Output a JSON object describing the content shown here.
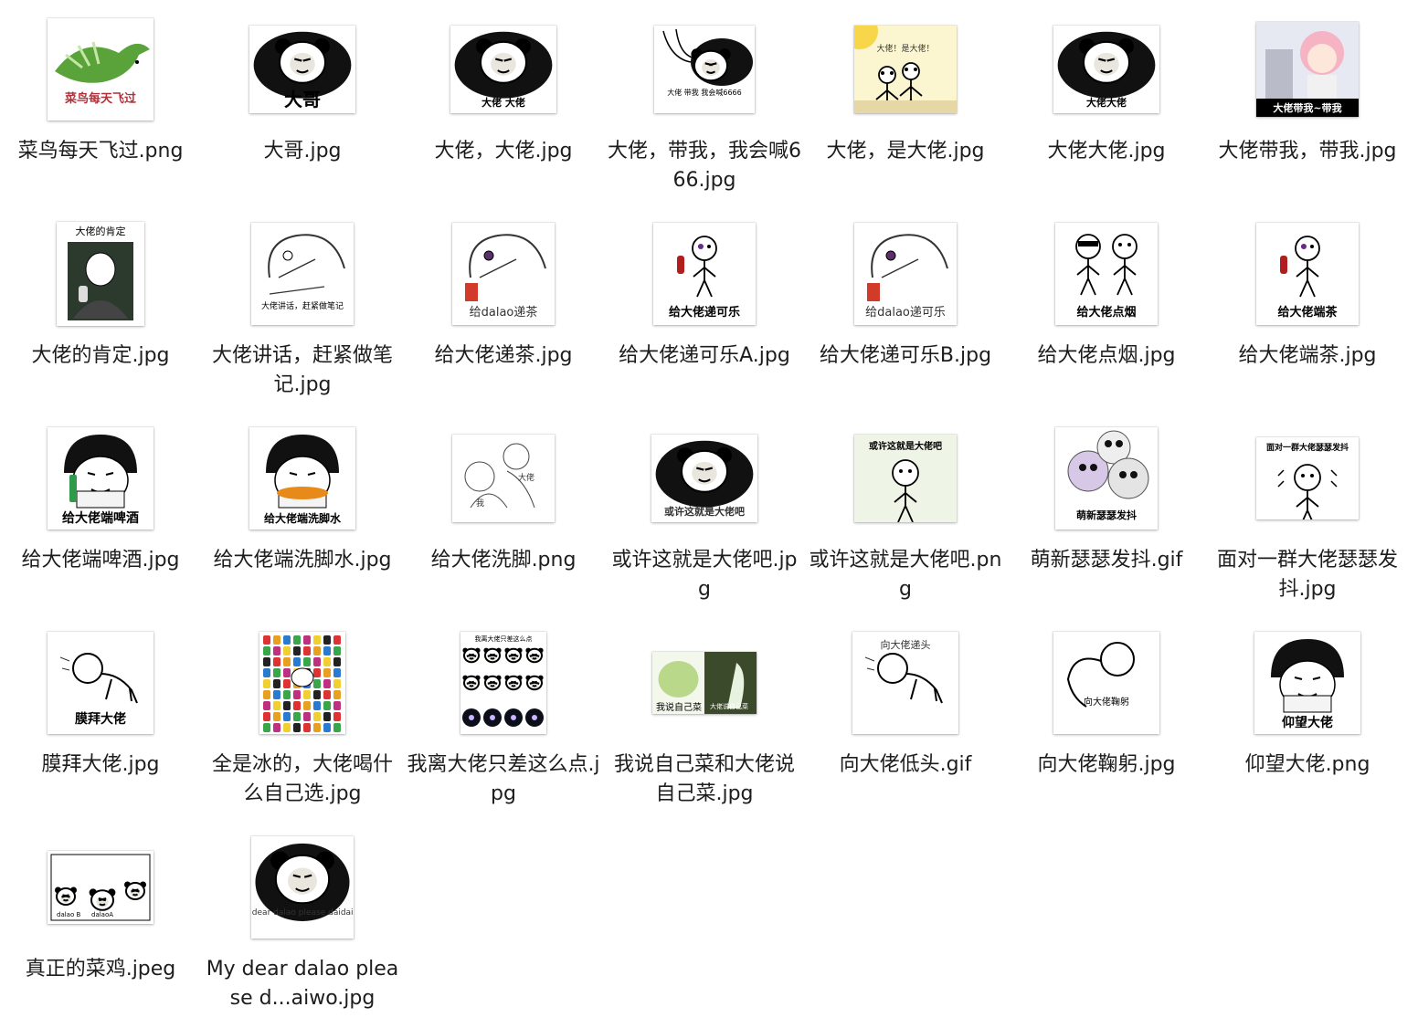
{
  "files": [
    {
      "name": "菜鸟每天飞过.png",
      "caption": "菜鸟每天飞过",
      "caption_color": "#b0303a",
      "kind": "bird"
    },
    {
      "name": "大哥.jpg",
      "caption": "大哥",
      "caption_color": "#000000",
      "kind": "panda"
    },
    {
      "name": "大佬，大佬.jpg",
      "caption": "大佬  大佬",
      "caption_color": "#000000",
      "kind": "panda"
    },
    {
      "name": "大佬，带我，我会喊666.jpg",
      "caption": "大佬 带我 我会喊6666",
      "caption_color": "#000000",
      "kind": "panda-lean"
    },
    {
      "name": "大佬，是大佬.jpg",
      "caption": "大佬！是大佬！",
      "caption_color": "#333333",
      "kind": "sun"
    },
    {
      "name": "大佬大佬.jpg",
      "caption": "大佬大佬",
      "caption_color": "#000000",
      "kind": "panda"
    },
    {
      "name": "大佬带我，带我.jpg",
      "caption": "大佬带我~带我",
      "caption_color": "#000000",
      "kind": "anime"
    },
    {
      "name": "大佬的肯定.jpg",
      "caption": "大佬的肯定",
      "caption_color": "#000000",
      "kind": "thumbsup"
    },
    {
      "name": "大佬讲话，赶紧做笔记.jpg",
      "caption": "大佬讲话，赶紧做笔记",
      "caption_color": "#000000",
      "kind": "sketch"
    },
    {
      "name": "给大佬递茶.jpg",
      "caption": "给dalao递茶",
      "caption_color": "#333333",
      "kind": "sketch-cup"
    },
    {
      "name": "给大佬递可乐A.jpg",
      "caption": "给大佬递可乐",
      "caption_color": "#000000",
      "kind": "stick-cola"
    },
    {
      "name": "给大佬递可乐B.jpg",
      "caption": "给dalao递可乐",
      "caption_color": "#333333",
      "kind": "sketch-cup"
    },
    {
      "name": "给大佬点烟.jpg",
      "caption": "给大佬点烟",
      "caption_color": "#000000",
      "kind": "stick-two"
    },
    {
      "name": "给大佬端茶.jpg",
      "caption": "给大佬端茶",
      "caption_color": "#000000",
      "kind": "stick-cola"
    },
    {
      "name": "给大佬端啤酒.jpg",
      "caption": "给大佬端啤酒",
      "caption_color": "#000000",
      "kind": "mushroom"
    },
    {
      "name": "给大佬端洗脚水.jpg",
      "caption": "给大佬端洗脚水",
      "caption_color": "#000000",
      "kind": "mushroom"
    },
    {
      "name": "给大佬洗脚.png",
      "caption": "大佬  我",
      "caption_color": "#333333",
      "kind": "sketch-two"
    },
    {
      "name": "或许这就是大佬吧.jpg",
      "caption": "或许这就是大佬吧",
      "caption_color": "#333333",
      "kind": "panda"
    },
    {
      "name": "或许这就是大佬吧.png",
      "caption": "或许这就是大佬吧",
      "caption_color": "#000000",
      "kind": "stick-green"
    },
    {
      "name": "萌新瑟瑟发抖.gif",
      "caption": "萌新瑟瑟发抖",
      "caption_color": "#000000",
      "kind": "skulls"
    },
    {
      "name": "面对一群大佬瑟瑟发抖.jpg",
      "caption": "面对一群大佬瑟瑟发抖",
      "caption_color": "#000000",
      "kind": "shiver"
    },
    {
      "name": "膜拜大佬.jpg",
      "caption": "膜拜大佬",
      "caption_color": "#000000",
      "kind": "kneel"
    },
    {
      "name": "全是冰的，大佬喝什么自己选.jpg",
      "caption": "",
      "caption_color": "#000000",
      "kind": "drinks"
    },
    {
      "name": "我离大佬只差这么点.jpg",
      "caption": "我离大佬只差这么点",
      "caption_color": "#000000",
      "kind": "panda-grid"
    },
    {
      "name": "我说自己菜和大佬说自己菜.jpg",
      "caption": "我说自己菜  大佬说自己菜",
      "caption_color": "#ffffff",
      "kind": "cabbage"
    },
    {
      "name": "向大佬低头.gif",
      "caption": "向大佬递头",
      "caption_color": "#333333",
      "kind": "kneel"
    },
    {
      "name": "向大佬鞠躬.jpg",
      "caption": "向大佬鞠躬",
      "caption_color": "#000000",
      "kind": "bow"
    },
    {
      "name": "仰望大佬.png",
      "caption": "仰望大佬",
      "caption_color": "#000000",
      "kind": "mushroom"
    },
    {
      "name": "真正的菜鸡.jpeg",
      "caption": "dalao B  dalaoA",
      "caption_color": "#000000",
      "kind": "three-pandas"
    },
    {
      "name": "My dear dalao please d...aiwo.jpg",
      "caption": "My dear dalao please daidaiwo.",
      "caption_color": "#333333",
      "kind": "panda-dear"
    }
  ]
}
